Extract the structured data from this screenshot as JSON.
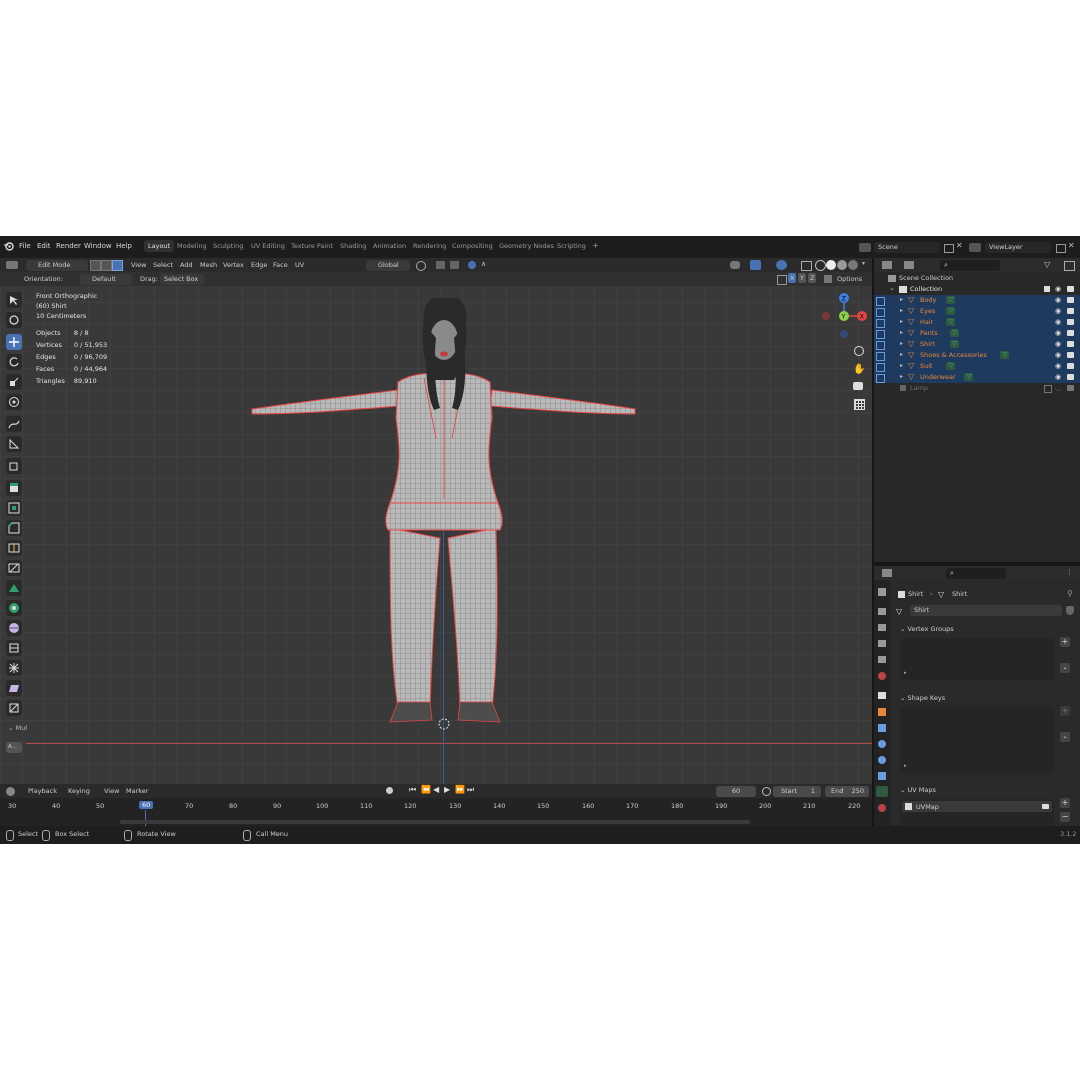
{
  "colors": {
    "accent": "#4772b3",
    "selection_edge": "#e64545",
    "object_orange": "#e8873a",
    "data_green": "#3ab58a",
    "panel_bg": "#303030",
    "viewport_bg": "#393939"
  },
  "menu": {
    "items": [
      "File",
      "Edit",
      "Render",
      "Window",
      "Help"
    ]
  },
  "workspaces": [
    "Layout",
    "Modeling",
    "Sculpting",
    "UV Editing",
    "Texture Paint",
    "Shading",
    "Animation",
    "Rendering",
    "Compositing",
    "Geometry Nodes",
    "Scripting"
  ],
  "workspace_add": "+",
  "scene": {
    "label": "Scene",
    "viewlayer": "ViewLayer"
  },
  "viewport_header": {
    "mode": "Edit Mode",
    "menus": [
      "View",
      "Select",
      "Add",
      "Mesh",
      "Vertex",
      "Edge",
      "Face",
      "UV"
    ],
    "transform_space": "Global"
  },
  "tool_header": {
    "orientation_label": "Orientation:",
    "orientation_value": "Default",
    "drag_label": "Drag:",
    "drag_value": "Select Box",
    "options": "Options"
  },
  "axis_toggles": [
    "X",
    "Y",
    "Z"
  ],
  "overlay_info": {
    "view": "Front Orthographic",
    "object": "(60) Shirt",
    "scale": "10 Centimeters",
    "stats": [
      {
        "label": "Objects",
        "value": "8 / 8"
      },
      {
        "label": "Vertices",
        "value": "0 / 51,953"
      },
      {
        "label": "Edges",
        "value": "0 / 96,709"
      },
      {
        "label": "Faces",
        "value": "0 / 44,964"
      },
      {
        "label": "Triangles",
        "value": "89,910"
      }
    ]
  },
  "gizmo": {
    "x": "X",
    "y": "Y",
    "z": "Z"
  },
  "last_op": {
    "title": "Mul",
    "field": "A..."
  },
  "timeline": {
    "menus": [
      "Playback",
      "Keying",
      "View",
      "Marker"
    ],
    "current_frame": "60",
    "start_label": "Start",
    "start": "1",
    "end_label": "End",
    "end": "250",
    "ticks": [
      "30",
      "40",
      "50",
      "60",
      "70",
      "80",
      "90",
      "100",
      "110",
      "120",
      "130",
      "140",
      "150",
      "160",
      "170",
      "180",
      "190",
      "200",
      "210",
      "220"
    ]
  },
  "status": {
    "select": "Select",
    "box_select": "Box Select",
    "rotate": "Rotate View",
    "call_menu": "Call Menu",
    "version": "3.1.2"
  },
  "outliner": {
    "scene_collection": "Scene Collection",
    "collection": "Collection",
    "items": [
      "Body",
      "Eyes",
      "Hair",
      "Pants",
      "Shirt",
      "Shoes & Accessories",
      "Suit",
      "Underwear"
    ],
    "lamp": "Lamp"
  },
  "properties": {
    "breadcrumb_object": "Shirt",
    "breadcrumb_data": "Shirt",
    "mesh_name": "Shirt",
    "vertex_groups": "Vertex Groups",
    "shape_keys": "Shape Keys",
    "uv_maps": "UV Maps",
    "uvmap_name": "UVMap"
  }
}
